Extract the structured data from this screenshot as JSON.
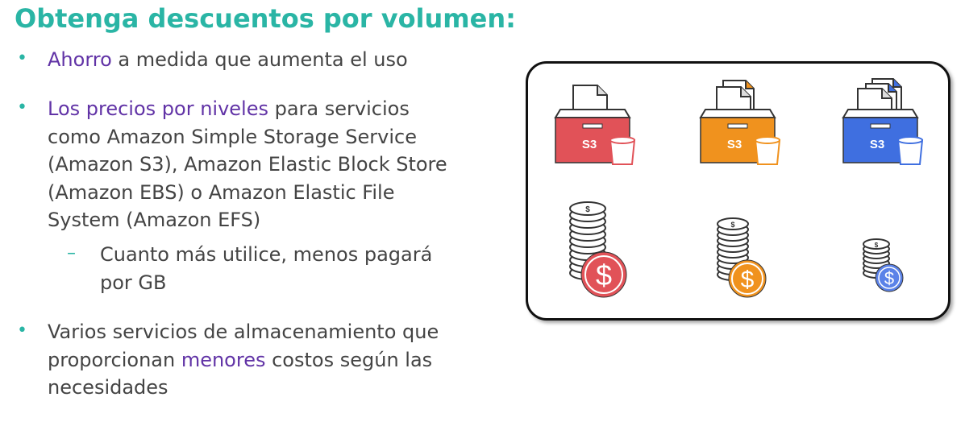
{
  "title": "Obtenga descuentos por volumen:",
  "bullets": {
    "b1": {
      "highlight": "Ahorro",
      "rest": " a medida que aumenta el uso"
    },
    "b2": {
      "highlight": "Los precios por niveles",
      "line1_rest": " para servicios",
      "line2": "como Amazon Simple Storage Service",
      "line3": "(Amazon S3), Amazon Elastic Block Store",
      "line4": "(Amazon EBS) o Amazon Elastic File",
      "line5": "System (Amazon EFS)"
    },
    "sub": {
      "line1": "Cuanto más utilice, menos pagará",
      "line2": "por GB"
    },
    "b3": {
      "line1": "Varios servicios de almacenamiento que",
      "line2_pre": "proporcionan ",
      "line2_highlight": "menores",
      "line2_post": " costos según las",
      "line3": "necesidades"
    },
    "bullet_symbol": "•",
    "dash_symbol": "–"
  },
  "panel": {
    "boxes": [
      {
        "label": "S3",
        "color": "#e15258",
        "docs": 1,
        "icon": "s3-bucket-icon"
      },
      {
        "label": "S3",
        "color": "#f0921e",
        "docs": 2,
        "icon": "s3-bucket-icon"
      },
      {
        "label": "S3",
        "color": "#3f6fe0",
        "docs": 3,
        "icon": "s3-bucket-icon"
      }
    ],
    "coins": [
      {
        "symbol": "$",
        "small_symbol": "$",
        "color": "#e15258",
        "icon": "coin-stack-icon"
      },
      {
        "symbol": "$",
        "small_symbol": "$",
        "color": "#f0921e",
        "icon": "coin-stack-icon"
      },
      {
        "symbol": "$",
        "small_symbol": "$",
        "color": "#5b82e8",
        "icon": "coin-stack-icon"
      }
    ]
  }
}
